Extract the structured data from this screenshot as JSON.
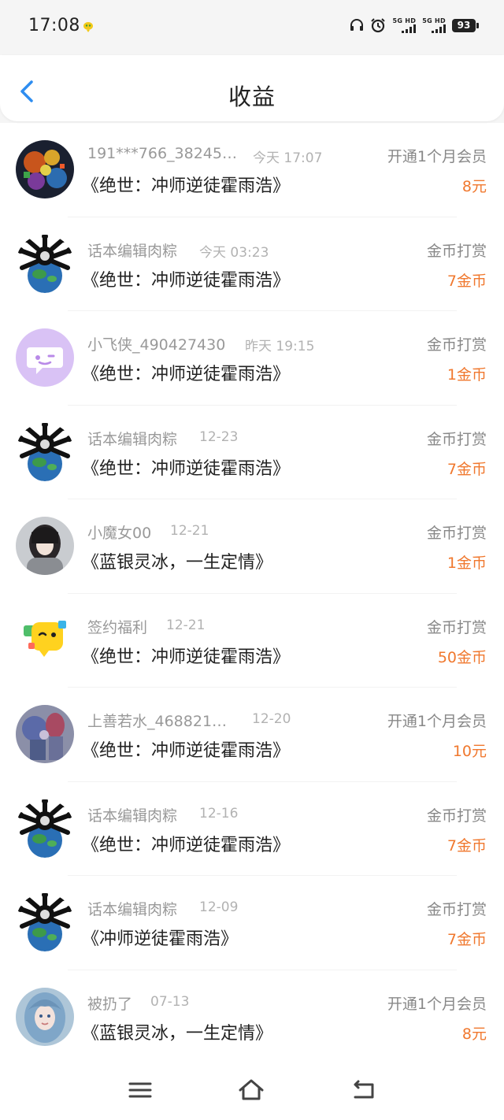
{
  "status_bar": {
    "time": "17:08",
    "signal_1_label": "5G HD",
    "signal_2_label": "5G HD",
    "battery": "93",
    "icons": [
      "app-notify-icon",
      "headphones-icon",
      "alarm-icon"
    ]
  },
  "header": {
    "title": "收益",
    "back_icon": "chevron-left-icon",
    "accent_color": "#2e8df0"
  },
  "colors": {
    "amount": "#f0782e",
    "name": "#999999",
    "title": "#222222"
  },
  "rows": [
    {
      "user": "191***766_38245…",
      "time": "今天 17:07",
      "book": "《绝世：冲师逆徒霍雨浩》",
      "type": "开通1个月会员",
      "amount": "8元",
      "avatar": "game-avatar"
    },
    {
      "user": "话本编辑肉粽",
      "time": "今天 03:23",
      "book": "《绝世：冲师逆徒霍雨浩》",
      "type": "金币打赏",
      "amount": "7金币",
      "avatar": "meme-earth-avatar"
    },
    {
      "user": "小飞侠_490427430",
      "time": "昨天 19:15",
      "book": "《绝世：冲师逆徒霍雨浩》",
      "type": "金币打赏",
      "amount": "1金币",
      "avatar": "chat-bubble-avatar"
    },
    {
      "user": "话本编辑肉粽",
      "time": "12-23",
      "book": "《绝世：冲师逆徒霍雨浩》",
      "type": "金币打赏",
      "amount": "7金币",
      "avatar": "meme-earth-avatar"
    },
    {
      "user": "小魔女00",
      "time": "12-21",
      "book": "《蓝银灵冰，一生定情》",
      "type": "金币打赏",
      "amount": "1金币",
      "avatar": "girl-photo-avatar"
    },
    {
      "user": "签约福利",
      "time": "12-21",
      "book": "《绝世：冲师逆徒霍雨浩》",
      "type": "金币打赏",
      "amount": "50金币",
      "avatar": "yellow-face-avatar"
    },
    {
      "user": "上善若水_468821…",
      "time": "12-20",
      "book": "《绝世：冲师逆徒霍雨浩》",
      "type": "开通1个月会员",
      "amount": "10元",
      "avatar": "anime-avatar"
    },
    {
      "user": "话本编辑肉粽",
      "time": "12-16",
      "book": "《绝世：冲师逆徒霍雨浩》",
      "type": "金币打赏",
      "amount": "7金币",
      "avatar": "meme-earth-avatar"
    },
    {
      "user": "话本编辑肉粽",
      "time": "12-09",
      "book": "《冲师逆徒霍雨浩》",
      "type": "金币打赏",
      "amount": "7金币",
      "avatar": "meme-earth-avatar"
    },
    {
      "user": "被扔了",
      "time": "07-13",
      "book": "《蓝银灵冰，一生定情》",
      "type": "开通1个月会员",
      "amount": "8元",
      "avatar": "blue-hair-girl-avatar"
    }
  ],
  "nav": {
    "icons": [
      "menu-icon",
      "home-icon",
      "back-icon"
    ]
  }
}
